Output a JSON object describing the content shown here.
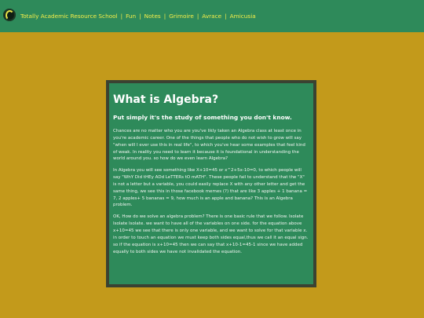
{
  "nav": {
    "items": [
      "Totally Academic Resource School",
      "Fun",
      "Notes",
      "Grimoire",
      "Avrace",
      "Amicusia"
    ],
    "separator": "|"
  },
  "article": {
    "title": "What is Algebra?",
    "subtitle": "Put simply it's the study of something you don't know.",
    "paragraphs": [
      "Chances are no matter who you are you've likly taken an Algebra class at least once in you're academic career. One of the things that people who do not wish to grow will say \"when will I ever use this in real life\", to which you've hear some examples that feel kind of weak. In reality you need to learn it because it is foundational in understanding the world around you. so how do we even learn Algebra?",
      "In Algebra you will see something like X+10=45 or x^2+5x-10=0, to which people will say \"WhY Did tHEy ADd LeTTERs tO mATH\". These people fail to understand that the \"X\" is not a letter but a variable, you could easily replace X with any other letter and get the same thing, we see this in those facebook memes (?) that are like 3 apples + 1 banana = 7, 2 apples+ 5 bananas = 9, how much is an apple and banana? This is an Algebra problem.",
      "OK, How do we solve an algebra problem? There is one basic rule that we follow. Isolate Isolate Isolate. we want to have all of the variables on one side. for the equation above x+10=45 we see that there is only one variable, and we want to solve for that variable x. in order to touch an equation we must keep both sides equal,thus we call it an equal sign. so if the equation is x+10=45 then we can say that x+10-1=45-1 since we have added equally to both sides we have not invalidated the equation."
    ]
  },
  "colors": {
    "background": "#c39a1b",
    "header": "#2e8a5a",
    "card": "#2e8a5a",
    "card_border": "#3a4232",
    "nav_text": "#f4ee4a"
  },
  "icons": {
    "logo": "site-logo-icon"
  }
}
